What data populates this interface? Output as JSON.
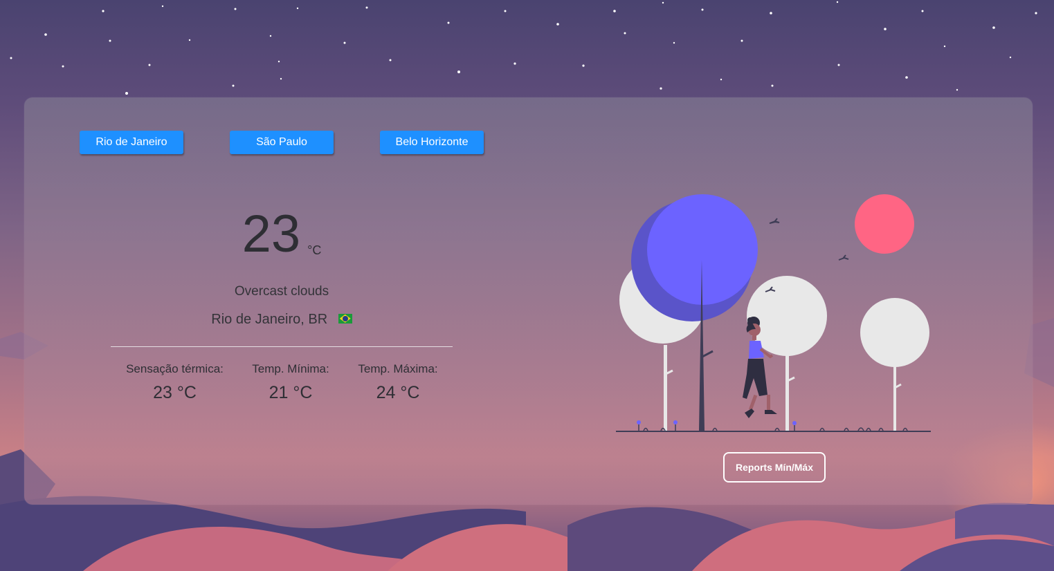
{
  "cities": [
    {
      "label": "Rio de Janeiro"
    },
    {
      "label": "São Paulo"
    },
    {
      "label": "Belo Horizonte"
    }
  ],
  "weather": {
    "temperature": "23",
    "unit": "°C",
    "description": "Overcast clouds",
    "location": "Rio de Janeiro, BR",
    "flag_icon": "brazil-flag-icon"
  },
  "stats": [
    {
      "label": "Sensação térmica:",
      "value": "23 °C"
    },
    {
      "label": "Temp. Mínima:",
      "value": "21 °C"
    },
    {
      "label": "Temp. Máxima:",
      "value": "24 °C"
    }
  ],
  "actions": {
    "reports_label": "Reports Mín/Máx"
  },
  "colors": {
    "button_blue": "#1e90ff",
    "tree_purple": "#6c63ff",
    "sun_pink": "#ff6584"
  }
}
